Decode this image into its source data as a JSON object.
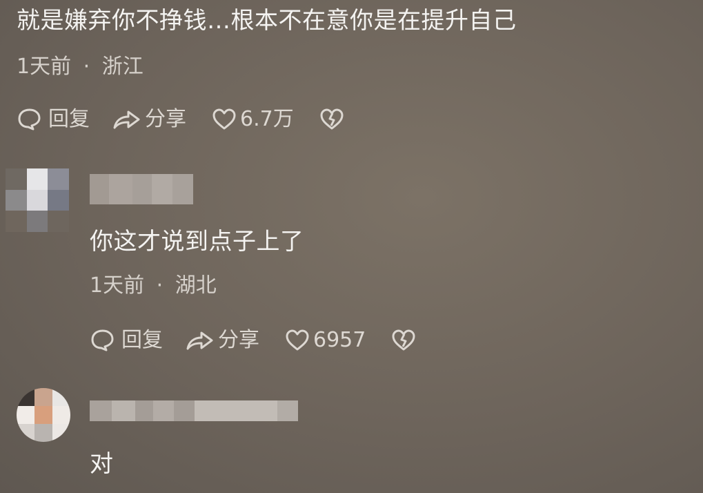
{
  "comments": [
    {
      "text": "就是嫌弃你不挣钱…根本不在意你是在提升自己",
      "time": "1天前",
      "location": "浙江",
      "reply_label": "回复",
      "share_label": "分享",
      "likes": "6.7万"
    },
    {
      "text": "你这才说到点子上了",
      "time": "1天前",
      "location": "湖北",
      "reply_label": "回复",
      "share_label": "分享",
      "likes": "6957"
    },
    {
      "text": "对"
    }
  ],
  "separator": "·",
  "icons": {
    "reply": "speech-bubble-icon",
    "share": "share-arrow-icon",
    "like": "heart-icon",
    "dislike": "broken-heart-icon"
  },
  "colors": {
    "background": "#6d645b",
    "text": "#f4f3f1",
    "meta": "#d6d1cb"
  }
}
